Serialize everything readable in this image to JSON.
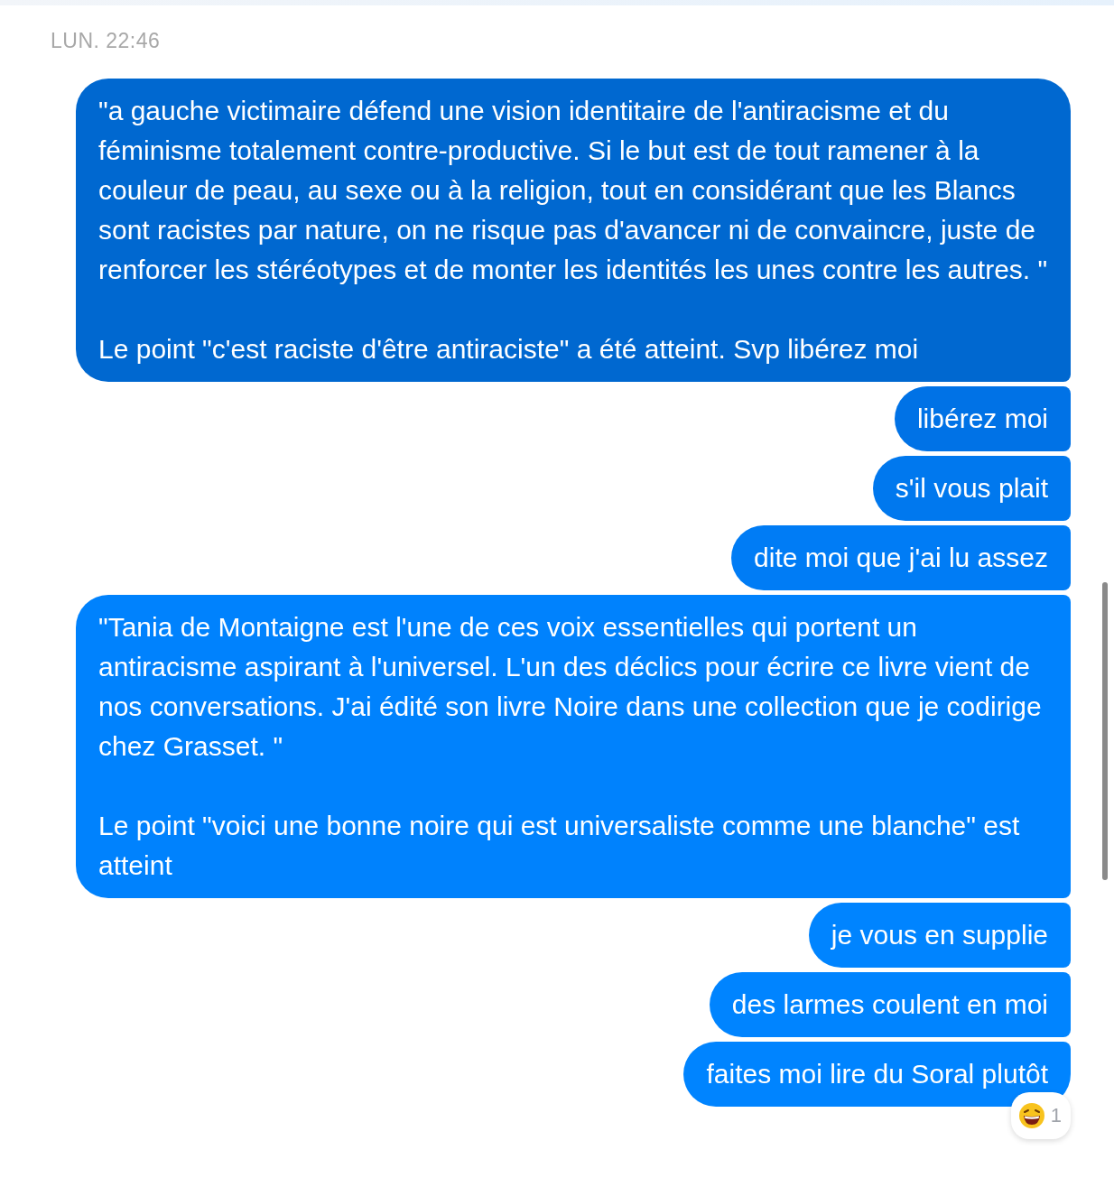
{
  "timestamp": "LUN. 22:46",
  "messages": [
    {
      "text": "\"a gauche victimaire défend une vision identitaire de l'antiracisme et du féminisme totalement contre-productive. Si le but est de tout ramener à la couleur de peau, au sexe ou à la religion, tout en considérant que les Blancs sont racistes par nature, on ne risque pas d'avancer ni de convaincre, juste de renforcer les stéréotypes et de monter les identités les unes contre les autres. \"\n\nLe point \"c'est raciste d'être antiraciste\" a été atteint. Svp libérez moi",
      "color": "#0068d0"
    },
    {
      "text": "libérez moi",
      "color": "#0072e6"
    },
    {
      "text": "s'il vous plait",
      "color": "#0078ee"
    },
    {
      "text": "dite moi que j'ai lu assez",
      "color": "#007cf5"
    },
    {
      "text": "\"Tania de Montaigne est l'une de ces voix essentielles qui portent un antiracisme aspirant à l'universel. L'un des déclics pour écrire ce livre vient de nos conversations. J'ai édité son livre Noire dans une collection que je codirige chez Grasset. \"\n\nLe point \"voici une bonne noire qui est universaliste comme une blanche\" est atteint",
      "color": "#0082fd"
    },
    {
      "text": "je vous en supplie",
      "color": "#0084ff"
    },
    {
      "text": "des larmes coulent en moi",
      "color": "#0084ff"
    },
    {
      "text": "faites moi lire du Soral plutôt",
      "color": "#0084ff",
      "reaction": {
        "count": "1"
      }
    }
  ]
}
